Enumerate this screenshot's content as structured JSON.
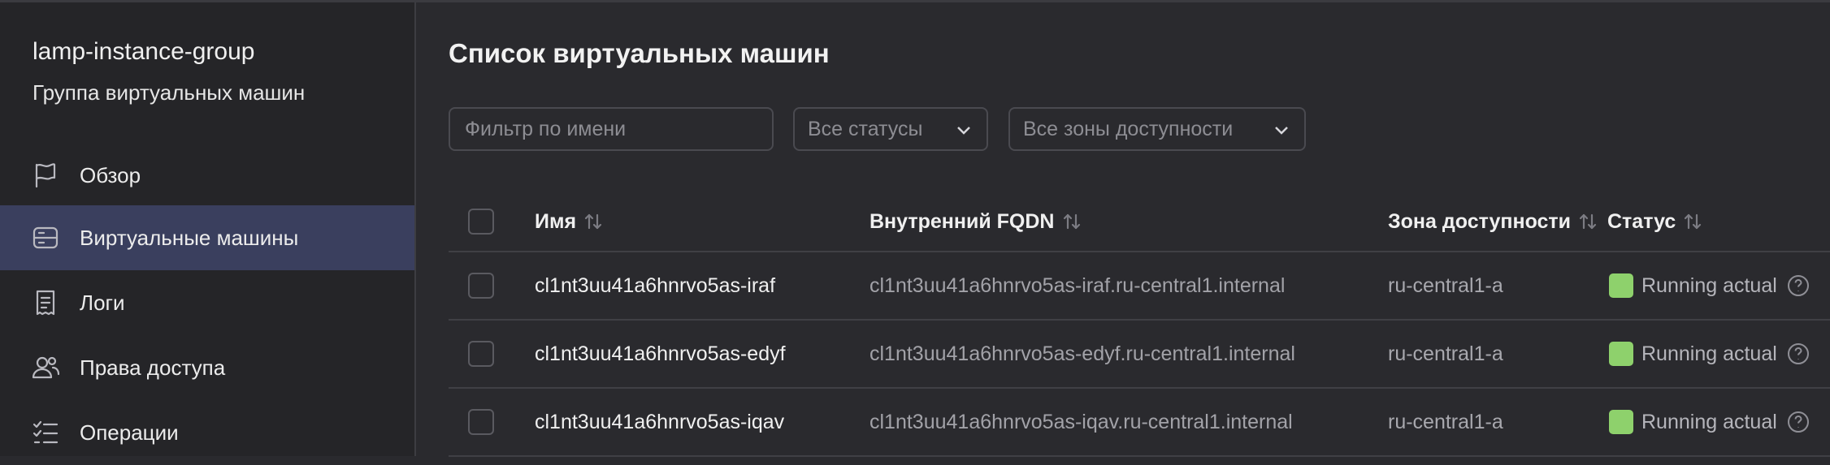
{
  "sidebar": {
    "title": "lamp-instance-group",
    "subtitle": "Группа виртуальных машин",
    "items": [
      {
        "label": "Обзор",
        "icon": "flag-icon"
      },
      {
        "label": "Виртуальные машины",
        "icon": "server-icon",
        "active": true
      },
      {
        "label": "Логи",
        "icon": "receipt-icon"
      },
      {
        "label": "Права доступа",
        "icon": "users-icon"
      },
      {
        "label": "Операции",
        "icon": "checklist-icon"
      }
    ]
  },
  "main": {
    "title": "Список виртуальных машин",
    "filters": {
      "name_placeholder": "Фильтр по имени",
      "status_label": "Все статусы",
      "zone_label": "Все зоны доступности"
    },
    "table": {
      "columns": [
        "Имя",
        "Внутренний FQDN",
        "Зона доступности",
        "Статус"
      ],
      "rows": [
        {
          "name": "cl1nt3uu41a6hnrvo5as-iraf",
          "fqdn": "cl1nt3uu41a6hnrvo5as-iraf.ru-central1.internal",
          "zone": "ru-central1-a",
          "status": "Running actual"
        },
        {
          "name": "cl1nt3uu41a6hnrvo5as-edyf",
          "fqdn": "cl1nt3uu41a6hnrvo5as-edyf.ru-central1.internal",
          "zone": "ru-central1-a",
          "status": "Running actual"
        },
        {
          "name": "cl1nt3uu41a6hnrvo5as-iqav",
          "fqdn": "cl1nt3uu41a6hnrvo5as-iqav.ru-central1.internal",
          "zone": "ru-central1-a",
          "status": "Running actual"
        }
      ]
    }
  },
  "colors": {
    "status_running": "#8ed16c",
    "active_nav": "#3a3f5e"
  }
}
